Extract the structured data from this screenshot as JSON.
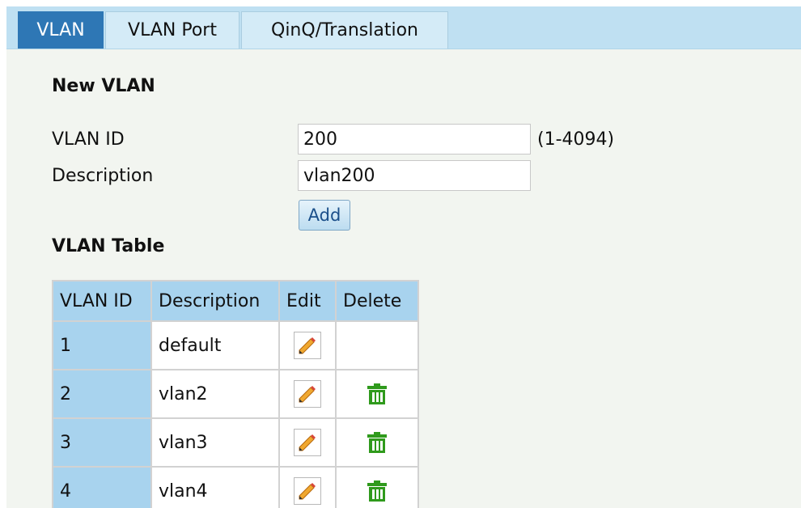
{
  "tabs": [
    {
      "label": "VLAN",
      "active": true
    },
    {
      "label": "VLAN Port",
      "active": false
    },
    {
      "label": "QinQ/Translation",
      "active": false
    }
  ],
  "new_vlan": {
    "title": "New VLAN",
    "vlan_id_label": "VLAN ID",
    "vlan_id_value": "200",
    "vlan_id_hint": "(1-4094)",
    "description_label": "Description",
    "description_value": "vlan200",
    "add_label": "Add"
  },
  "vlan_table": {
    "title": "VLAN Table",
    "headers": [
      "VLAN ID",
      "Description",
      "Edit",
      "Delete"
    ],
    "rows": [
      {
        "id": "1",
        "description": "default",
        "edit_icon": "pencil-edit-icon",
        "delete_icon": null
      },
      {
        "id": "2",
        "description": "vlan2",
        "edit_icon": "pencil-edit-icon",
        "delete_icon": "trash-delete-icon"
      },
      {
        "id": "3",
        "description": "vlan3",
        "edit_icon": "pencil-edit-icon",
        "delete_icon": "trash-delete-icon"
      },
      {
        "id": "4",
        "description": "vlan4",
        "edit_icon": "pencil-edit-icon",
        "delete_icon": "trash-delete-icon"
      }
    ]
  },
  "colors": {
    "tab_active_bg": "#2e77b5",
    "tab_bar_bg": "#bfe0f2",
    "table_header_bg": "#a8d3ee",
    "delete_icon_green": "#2f9a1c",
    "edit_icon_orange": "#e08a1e"
  }
}
